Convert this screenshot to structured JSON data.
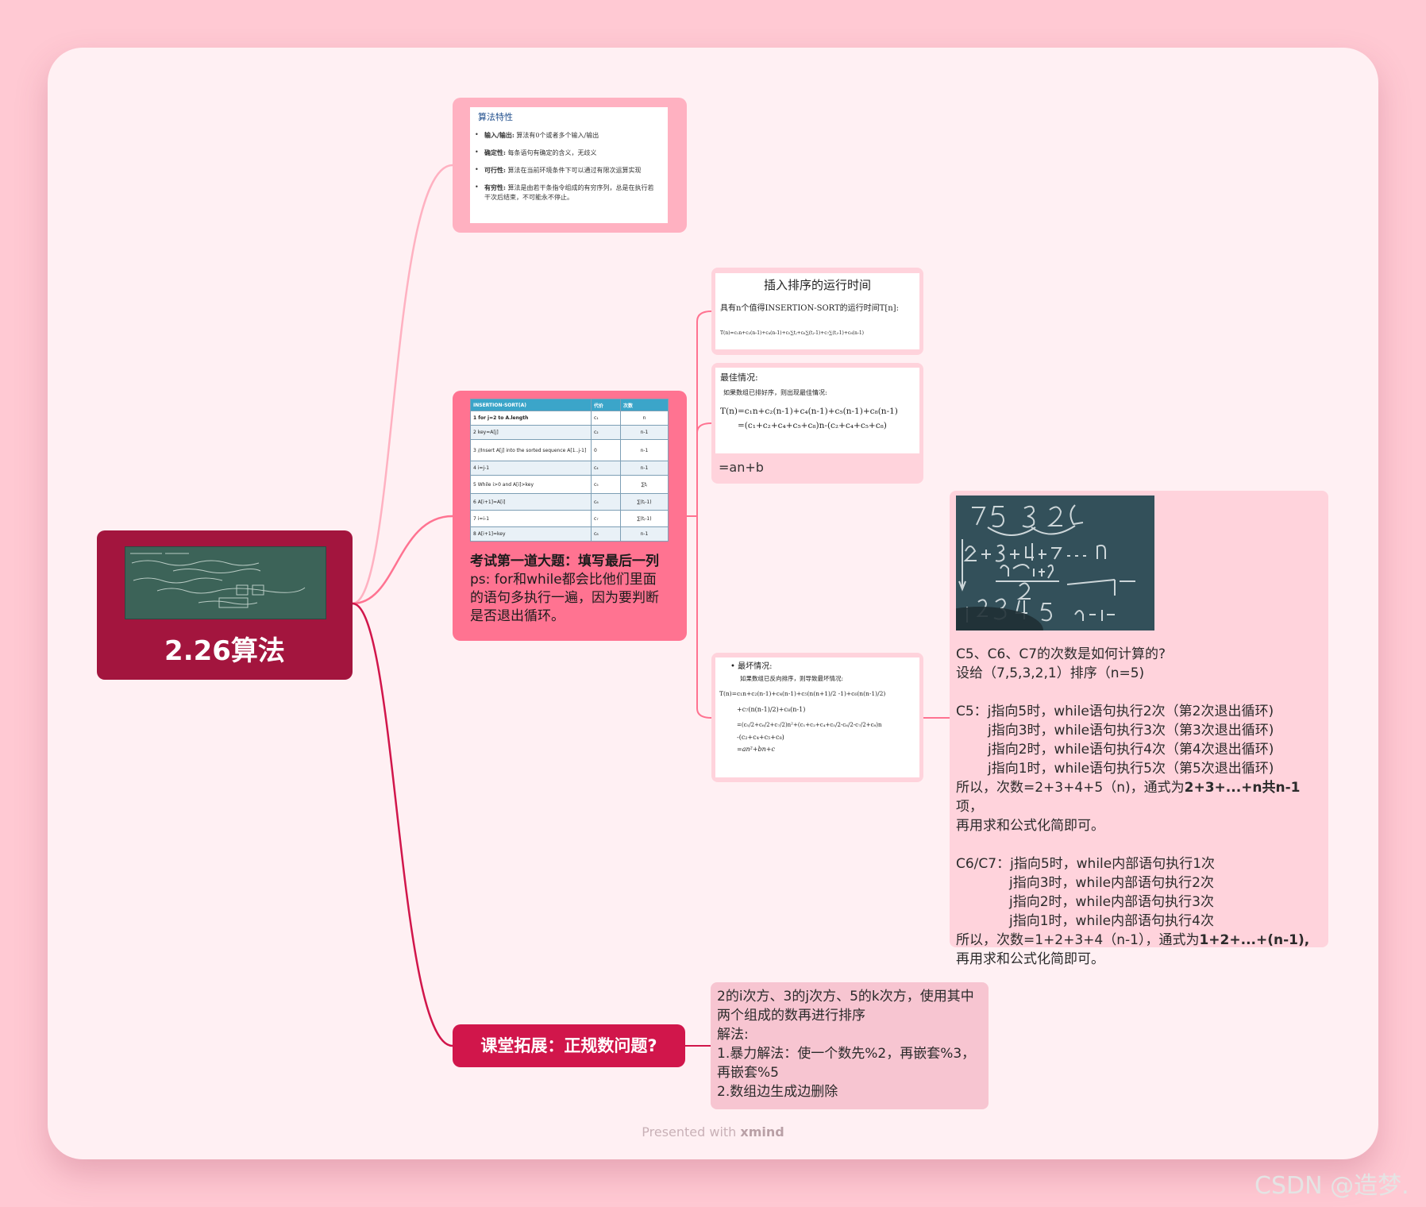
{
  "root": {
    "title": "2.26算法",
    "image": "blackboard-photo"
  },
  "node_props": {
    "title": "算法特性",
    "items": [
      {
        "term": "输入/输出:",
        "desc": "算法有0个或者多个输入/输出"
      },
      {
        "term": "确定性:",
        "desc": "每条语句有确定的含义，无歧义"
      },
      {
        "term": "可行性:",
        "desc": "算法在当前环境条件下可以通过有限次运算实现"
      },
      {
        "term": "有穷性:",
        "desc": "算法是由若干条指令组成的有穷序列，总是在执行若干次后结束，不可能永不停止。"
      }
    ]
  },
  "node_table": {
    "headers": [
      "INSERTION-SORT(A)",
      "代价",
      "次数"
    ],
    "rows": [
      [
        "1  for j=2 to A.length",
        "c₁",
        "n"
      ],
      [
        "2     key=A[j]",
        "c₂",
        "n-1"
      ],
      [
        "3     //Insert A[j] into the sorted sequence A[1..j-1]",
        "0",
        "n-1"
      ],
      [
        "4     i=j-1",
        "c₄",
        "n-1"
      ],
      [
        "5     While i>0 and A[i]>key",
        "c₅",
        "∑tⱼ"
      ],
      [
        "6        A[i+1]=A[i]",
        "c₆",
        "∑(tⱼ-1)"
      ],
      [
        "7        i=i-1",
        "c₇",
        "∑(tⱼ-1)"
      ],
      [
        "8     A[i+1]=key",
        "c₈",
        "n-1"
      ]
    ],
    "caption": "考试第一道大题：填写最后一列",
    "note": "ps: for和while都会比他们里面的语句多执行一遍，因为要判断是否退出循环。"
  },
  "node_runtime": {
    "title": "插入排序的运行时间",
    "line": "具有n个值得INSERTION-SORT的运行时间T[n]:",
    "formula": "T(n)=c₁n+c₂(n-1)+c₄(n-1)+c₅∑tⱼ+c₆∑(tⱼ-1)+c₇∑(tⱼ-1)+c₈(n-1)"
  },
  "node_best": {
    "title": "最佳情况:",
    "desc": "如果数组已排好序，则出现最佳情况:",
    "formula1": "T(n)=c₁n+c₂(n-1)+c₄(n-1)+c₅(n-1)+c₈(n-1)",
    "formula2": "=(c₁+c₂+c₄+c₅+c₈)n-(c₂+c₄+c₅+c₈)",
    "note": "=an+b"
  },
  "node_worst": {
    "title": "最坏情况:",
    "desc": "如果数组已反向排序，则导致最坏情况:",
    "f1": "T(n)=c₁n+c₂(n-1)+c₄(n-1)+c₅(n(n+1)/2 -1)+c₆(n(n-1)/2)",
    "f2": "+c₇(n(n-1)/2)+c₈(n-1)",
    "f3": "=(c₅/2+c₆/2+c₇/2)n²+(c₁+c₂+c₄+c₅/2-c₆/2-c₇/2+c₈)n",
    "f4": "-(c₂+c₄+c₅+c₈)",
    "f5": "=an²+bn+c"
  },
  "node_calc": {
    "image": "blackboard-calc-photo",
    "l1": "C5、C6、C7的次数是如何计算的?",
    "l2": "设给（7,5,3,2,1）排序（n=5)",
    "c5_1": "C5：j指向5时，while语句执行2次（第2次退出循环)",
    "c5_2": "j指向3时，while语句执行3次（第3次退出循环)",
    "c5_3": "j指向2时，while语句执行4次（第4次退出循环)",
    "c5_4": "j指向1时，while语句执行5次（第5次退出循环)",
    "c5_s1": "所以，次数=2+3+4+5（n)，通式为",
    "c5_s1b": "2+3+...+n共n-1",
    "c5_s1c": "项，",
    "c5_s2": "再用求和公式化简即可。",
    "c6_1": "C6/C7：j指向5时，while内部语句执行1次",
    "c6_2": "j指向3时，while内部语句执行2次",
    "c6_3": "j指向2时，while内部语句执行3次",
    "c6_4": "j指向1时，while内部语句执行4次",
    "c6_s1": "所以，次数=1+2+3+4（n-1），通式为",
    "c6_s1b": "1+2+...+(n-1),",
    "c6_s2": "再用求和公式化简即可。"
  },
  "node_ext": {
    "label": "课堂拓展：正规数问题?",
    "l1": "2的i次方、3的j次方、5的k次方，使用其中",
    "l2": "两个组成的数再进行排序",
    "l3": "解法:",
    "l4": "1.暴力解法：使一个数先%2，再嵌套%3，",
    "l5": "再嵌套%5",
    "l6": "2.数组边生成边删除"
  },
  "footer": {
    "prefix": "Presented with",
    "brand": "xmind"
  },
  "watermark": "CSDN @造梦.",
  "colors": {
    "background": "#ffc9d3",
    "root": "#a3153e",
    "branch_props": "#ffb1c1",
    "branch_table": "#ff7391",
    "branch_ext": "#d1164b",
    "subtopic": "#ffd3dc"
  }
}
